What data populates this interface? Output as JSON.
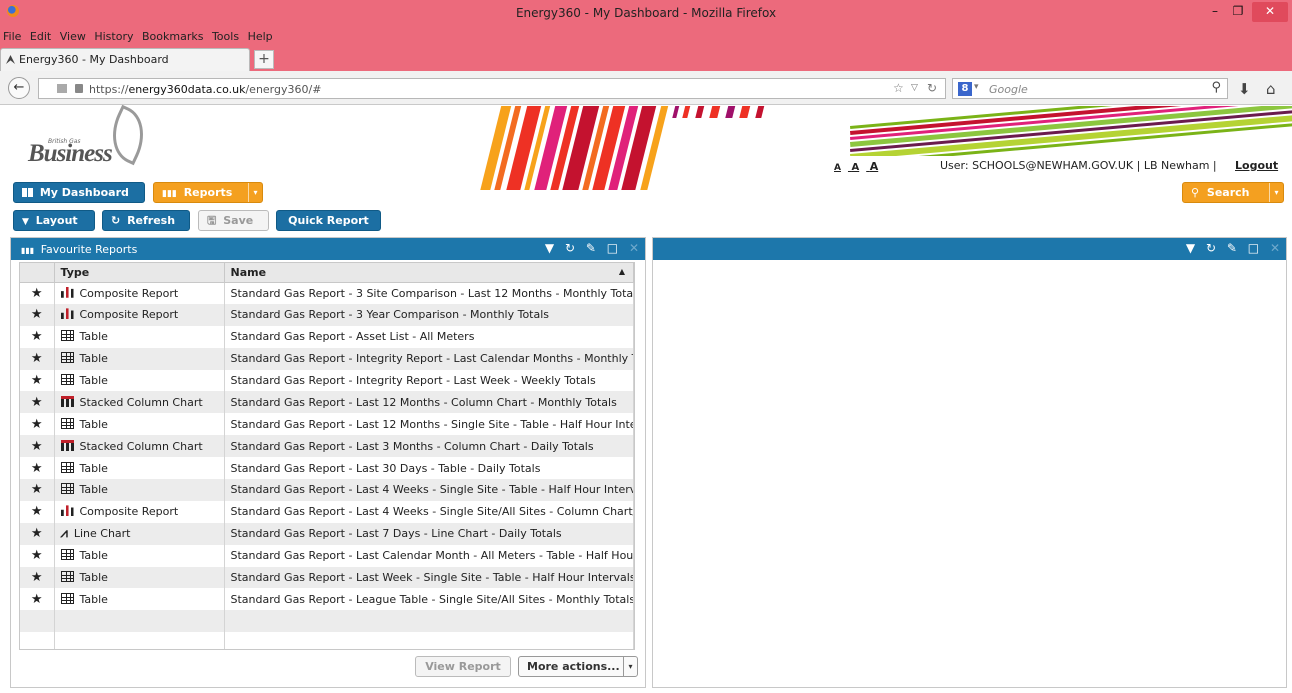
{
  "window": {
    "title": "Energy360 - My Dashboard - Mozilla Firefox"
  },
  "menu": [
    "File",
    "Edit",
    "View",
    "History",
    "Bookmarks",
    "Tools",
    "Help"
  ],
  "tab": {
    "label": "Energy360 - My Dashboard"
  },
  "browser": {
    "url_prefix": "https://",
    "url_host": "energy360data.co.uk",
    "url_path": "/energy360/#",
    "search_placeholder": "Google"
  },
  "header": {
    "brand_small": "British Gas",
    "brand": "Business",
    "font_sizes": [
      "A",
      "A",
      "A"
    ],
    "user": "User: SCHOOLS@NEWHAM.GOV.UK | LB Newham  |",
    "logout": "Logout"
  },
  "toolbar": {
    "dashboard": "My Dashboard",
    "reports": "Reports",
    "search": "Search",
    "layout": "Layout",
    "refresh": "Refresh",
    "save": "Save",
    "quick_report": "Quick Report"
  },
  "panel": {
    "title": "Favourite Reports",
    "columns": [
      "Type",
      "Name"
    ],
    "rows": [
      {
        "type": "Composite Report",
        "icon": "composite-icon",
        "name": "Standard Gas Report - 3 Site Comparison - Last 12 Months - Monthly Totals"
      },
      {
        "type": "Composite Report",
        "icon": "composite-icon",
        "name": "Standard Gas Report - 3 Year Comparison - Monthly Totals"
      },
      {
        "type": "Table",
        "icon": "table-icon",
        "name": "Standard Gas Report - Asset List - All Meters"
      },
      {
        "type": "Table",
        "icon": "table-icon",
        "name": "Standard Gas Report - Integrity Report - Last Calendar Months - Monthly Totals"
      },
      {
        "type": "Table",
        "icon": "table-icon",
        "name": "Standard Gas Report - Integrity Report - Last Week - Weekly Totals"
      },
      {
        "type": "Stacked Column Chart",
        "icon": "stacked-column-icon",
        "name": "Standard Gas Report - Last 12 Months - Column Chart - Monthly Totals"
      },
      {
        "type": "Table",
        "icon": "table-icon",
        "name": "Standard Gas Report - Last 12 Months - Single Site - Table - Half Hour Intervals"
      },
      {
        "type": "Stacked Column Chart",
        "icon": "stacked-column-icon",
        "name": "Standard Gas Report - Last 3 Months - Column Chart - Daily Totals"
      },
      {
        "type": "Table",
        "icon": "table-icon",
        "name": "Standard Gas Report - Last 30 Days - Table - Daily Totals"
      },
      {
        "type": "Table",
        "icon": "table-icon",
        "name": "Standard Gas Report - Last 4 Weeks - Single Site - Table - Half Hour Intervals"
      },
      {
        "type": "Composite Report",
        "icon": "composite-icon",
        "name": "Standard Gas Report - Last 4 Weeks - Single Site/All Sites - Column Chart/Table"
      },
      {
        "type": "Line Chart",
        "icon": "line-chart-icon",
        "name": "Standard Gas Report - Last 7 Days - Line Chart - Daily Totals"
      },
      {
        "type": "Table",
        "icon": "table-icon",
        "name": "Standard Gas Report - Last Calendar Month - All Meters - Table - Half Hour Intervals"
      },
      {
        "type": "Table",
        "icon": "table-icon",
        "name": "Standard Gas Report - Last Week - Single Site - Table - Half Hour Intervals"
      },
      {
        "type": "Table",
        "icon": "table-icon",
        "name": "Standard Gas Report - League Table - Single Site/All Sites - Monthly Totals"
      }
    ],
    "view_report": "View Report",
    "more_actions": "More actions..."
  },
  "colors": {
    "panel_header": "#1d77ab",
    "accent_orange": "#f4a020",
    "titlebar": "#ec6a7c"
  }
}
